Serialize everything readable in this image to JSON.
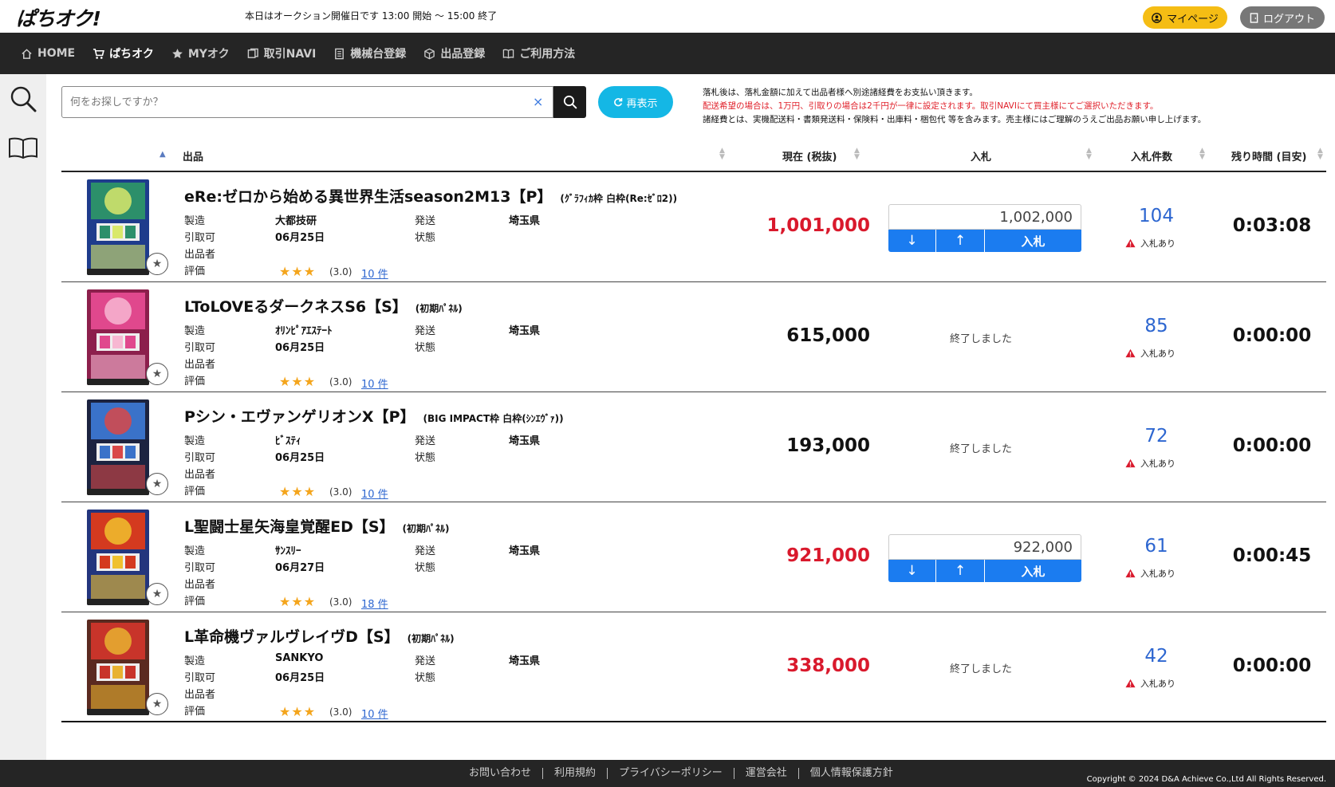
{
  "header": {
    "logo": "ぱちオク!",
    "announcement": "本日はオークション開催日です 13:00 開始 〜 15:00 終了",
    "mypage_label": "マイページ",
    "logout_label": "ログアウト"
  },
  "nav": {
    "items": [
      {
        "label": "HOME"
      },
      {
        "label": "ぱちオク"
      },
      {
        "label": "MYオク"
      },
      {
        "label": "取引NAVI"
      },
      {
        "label": "機械台登録"
      },
      {
        "label": "出品登録"
      },
      {
        "label": "ご利用方法"
      }
    ]
  },
  "search": {
    "placeholder": "何をお探しですか？",
    "clear": "×",
    "refresh_label": "再表示"
  },
  "notice": {
    "line1": "落札後は、落札金額に加えて出品者様へ別途諸経費をお支払い頂きます。",
    "line2": "配送希望の場合は、1万円、引取りの場合は2千円が一律に設定されます。取引NAVIにて買主様にてご選択いただきます。",
    "line3": "諸経費とは、実機配送料・書類発送料・保険料・出庫料・梱包代 等を含みます。売主様にはご理解のうえご出品お願い申し上げます。"
  },
  "table": {
    "col_item": "出品",
    "col_price": "現在 (税抜)",
    "col_bid": "入札",
    "col_count": "入札件数",
    "col_time": "残り時間 (目安)"
  },
  "labels": {
    "maker": "製造",
    "ship": "発送",
    "pickup": "引取可",
    "state": "状態",
    "seller": "出品者",
    "rating": "評価",
    "bid_button": "入札",
    "ended": "終了しました",
    "bid_status": "入札あり",
    "down": "↓",
    "up": "↑"
  },
  "listings": [
    {
      "title": "eRe:ゼロから始める異世界生活season2M13【P】",
      "subtitle": "(ｸﾞﾗﾌｨｶ枠 白枠(Re:ｾﾞﾛ2))",
      "maker": "大都技研",
      "ship": "埼玉県",
      "pickup": "06月25日",
      "state": "",
      "stars": "★★★",
      "score": "(3.0)",
      "reviews": "10 件",
      "price": "1,001,000",
      "price_color": "#d9192c",
      "bid_open": true,
      "bid_value": "1,002,000",
      "count": "104",
      "time": "0:03:08",
      "thumb_colors": [
        "#2c8f6a",
        "#d9e86b",
        "#1e3c8c"
      ]
    },
    {
      "title": "LToLOVEるダークネスS6【S】",
      "subtitle": "(初期ﾊﾟﾈﾙ)",
      "maker": "ｵﾘﾝﾋﾟｱｴｽﾃｰﾄ",
      "ship": "埼玉県",
      "pickup": "06月25日",
      "state": "",
      "stars": "★★★",
      "score": "(3.0)",
      "reviews": "10 件",
      "price": "615,000",
      "price_color": "#111111",
      "bid_open": false,
      "bid_value": "",
      "count": "85",
      "time": "0:00:00",
      "thumb_colors": [
        "#e0488d",
        "#f7b7d2",
        "#8c1f4c"
      ]
    },
    {
      "title": "Pシン・エヴァンゲリオンX【P】",
      "subtitle": "(BIG IMPACT枠 白枠(ｼﾝｴｳﾞｧ))",
      "maker": "ﾋﾞｽﾃｨ",
      "ship": "埼玉県",
      "pickup": "06月25日",
      "state": "",
      "stars": "★★★",
      "score": "(3.0)",
      "reviews": "10 件",
      "price": "193,000",
      "price_color": "#111111",
      "bid_open": false,
      "bid_value": "",
      "count": "72",
      "time": "0:00:00",
      "thumb_colors": [
        "#3a72c9",
        "#d94848",
        "#1c2340"
      ]
    },
    {
      "title": "L聖闘士星矢海皇覚醒ED【S】",
      "subtitle": "(初期ﾊﾟﾈﾙ)",
      "maker": "ｻﾝｽﾘｰ",
      "ship": "埼玉県",
      "pickup": "06月27日",
      "state": "",
      "stars": "★★★",
      "score": "(3.0)",
      "reviews": "18 件",
      "price": "921,000",
      "price_color": "#d9192c",
      "bid_open": true,
      "bid_value": "922,000",
      "count": "61",
      "time": "0:00:45",
      "thumb_colors": [
        "#d43a1f",
        "#f0c12e",
        "#23357d"
      ]
    },
    {
      "title": "L革命機ヴァルヴレイヴD【S】",
      "subtitle": "(初期ﾊﾟﾈﾙ)",
      "maker": "SANKYO",
      "ship": "埼玉県",
      "pickup": "06月25日",
      "state": "",
      "stars": "★★★",
      "score": "(3.0)",
      "reviews": "10 件",
      "price": "338,000",
      "price_color": "#d9192c",
      "bid_open": false,
      "bid_value": "",
      "count": "42",
      "time": "0:00:00",
      "thumb_colors": [
        "#c8342a",
        "#e8b230",
        "#5b2a20"
      ]
    }
  ],
  "footer": {
    "links": [
      "お問い合わせ",
      "利用規約",
      "プライバシーポリシー",
      "運営会社",
      "個人情報保護方針"
    ],
    "copyright": "Copyright © 2024 D&A Achieve Co.,Ltd All Rights Reserved."
  }
}
